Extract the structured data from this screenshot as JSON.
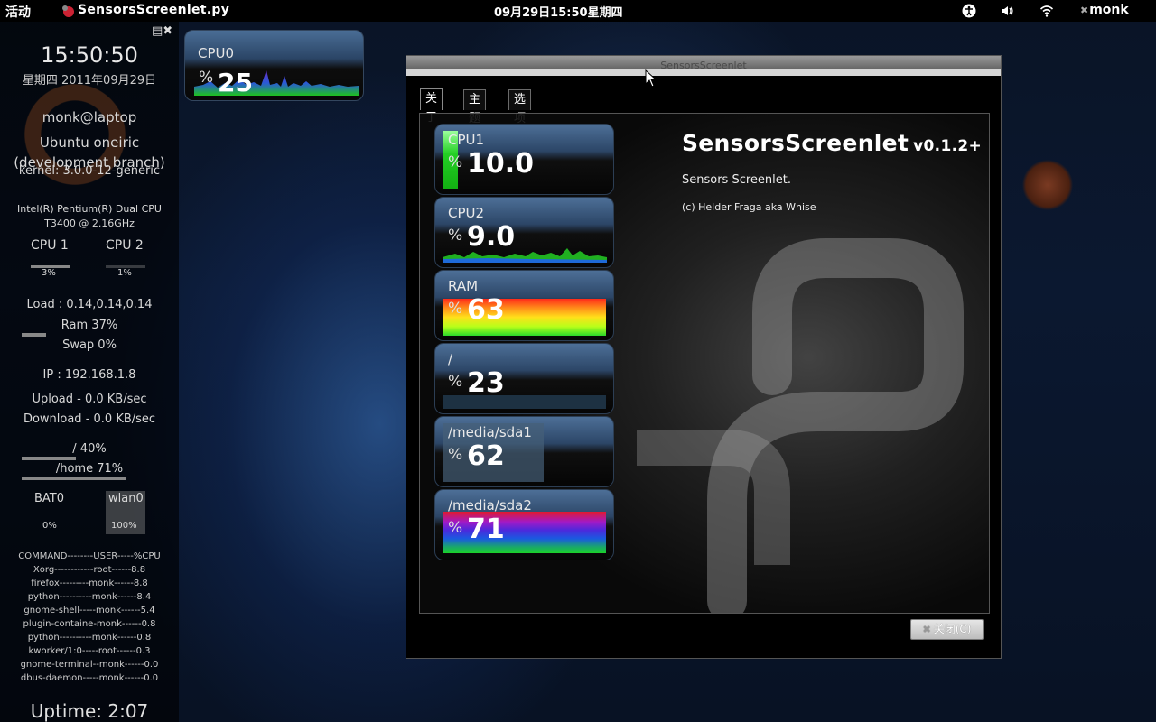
{
  "topbar": {
    "activities": "活动",
    "app_title": "SensorsScreenlet.py",
    "clock": "09月29日15:50星期四",
    "user": "monk",
    "tray_icons": [
      "accessibility-icon",
      "volume-icon",
      "wifi-icon"
    ]
  },
  "conky": {
    "time": "15:50:50",
    "date": "星期四 2011年09月29日",
    "user_host": "monk@laptop",
    "os": "Ubuntu oneiric",
    "dev": "(development branch)",
    "kernel": "kernel: 3.0.0-12-generic",
    "cpu_name": "Intel(R) Pentium(R) Dual  CPU   T3400  @ 2.16GHz",
    "cpu1_label": "CPU 1",
    "cpu2_label": "CPU 2",
    "cpu1_value": "3%",
    "cpu2_value": "1%",
    "load": "Load : 0.14,0.14,0.14",
    "ram": "Ram 37%",
    "swap": "Swap 0%",
    "ip": "IP : 192.168.1.8",
    "upload": "Upload - 0.0 KB/sec",
    "download": "Download - 0.0 KB/sec",
    "root_fs": "/ 40%",
    "home_fs": "/home 71%",
    "bat_label": "BAT0",
    "wlan_label": "wlan0",
    "bat_value": "0%",
    "wlan_value": "100%",
    "processes": [
      "COMMAND--------USER-----%CPU",
      "Xorg------------root------8.8",
      "firefox---------monk------8.8",
      "python----------monk------8.4",
      "gnome-shell-----monk------5.4",
      "plugin-containe-monk------0.8",
      "python----------monk------0.8",
      "kworker/1:0-----root------0.3",
      "gnome-terminal--monk------0.0",
      "dbus-daemon-----monk------0.0"
    ],
    "uptime": "Uptime: 2:07"
  },
  "cpu0_widget": {
    "label": "CPU0",
    "pct_symbol": "%",
    "value": "25"
  },
  "window": {
    "title": "SensorsScreenlet",
    "tabs": [
      "关于",
      "主题",
      "选项"
    ],
    "about": {
      "name": "SensorsScreenlet",
      "version": "v0.1.2+",
      "description": "Sensors Screenlet.",
      "copyright": "(c) Helder Fraga aka Whise"
    },
    "meters": [
      {
        "label": "CPU1",
        "value": "10.0",
        "level": 0.1,
        "style": "vbar"
      },
      {
        "label": "CPU2",
        "value": "9.0",
        "level": 0.09,
        "style": "graph"
      },
      {
        "label": "RAM",
        "value": "63",
        "level": 0.63,
        "style": "rainbow"
      },
      {
        "label": "/",
        "value": "23",
        "level": 0.23,
        "style": "dark"
      },
      {
        "label": "/media/sda1",
        "value": "62",
        "level": 0.62,
        "style": "hbar"
      },
      {
        "label": "/media/sda2",
        "value": "71",
        "level": 0.71,
        "style": "rainbow2"
      }
    ],
    "pct_symbol": "%",
    "close_button": "关闭(C)"
  }
}
